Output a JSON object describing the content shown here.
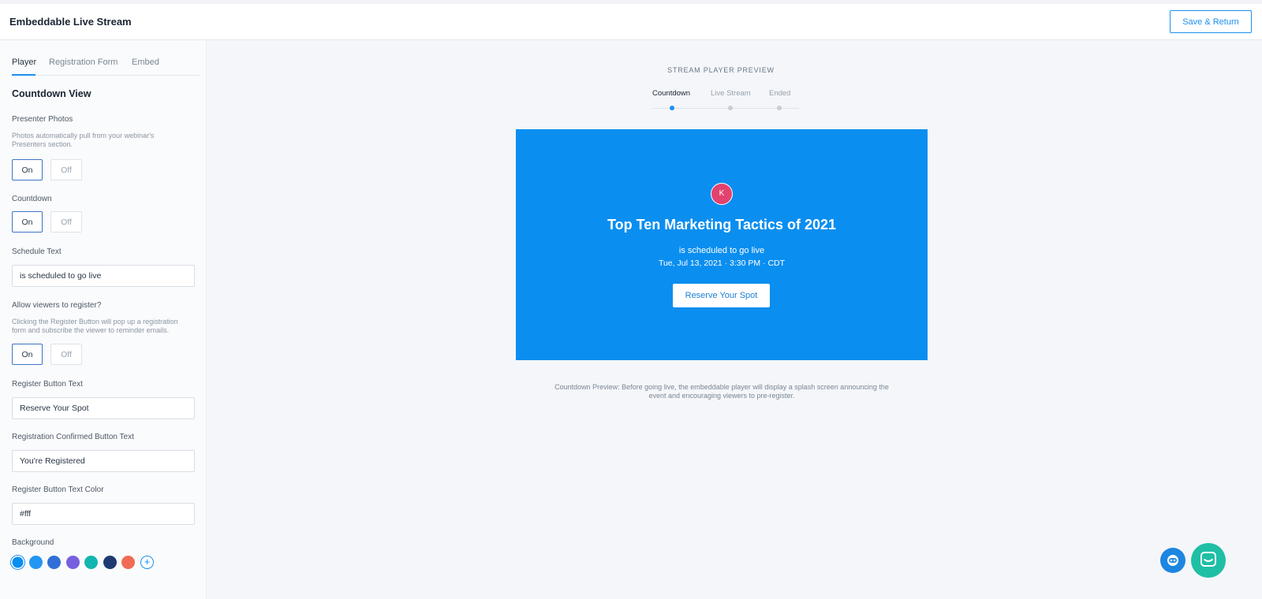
{
  "header": {
    "title": "Embeddable Live Stream",
    "save_label": "Save & Return"
  },
  "sidebar": {
    "tabs": [
      "Player",
      "Registration Form",
      "Embed"
    ],
    "active_tab": "Player",
    "section_title": "Countdown View",
    "presenter_photos": {
      "label": "Presenter Photos",
      "help": "Photos automatically pull from your webinar's Presenters section.",
      "on_label": "On",
      "off_label": "Off",
      "value": "On"
    },
    "countdown": {
      "label": "Countdown",
      "on_label": "On",
      "off_label": "Off",
      "value": "On"
    },
    "schedule_text": {
      "label": "Schedule Text",
      "value": "is scheduled to go live"
    },
    "allow_register": {
      "label": "Allow viewers to register?",
      "help": "Clicking the Register Button will pop up a registration form and subscribe the viewer to reminder emails.",
      "on_label": "On",
      "off_label": "Off",
      "value": "On"
    },
    "register_button_text": {
      "label": "Register Button Text",
      "value": "Reserve Your Spot"
    },
    "confirmed_button_text": {
      "label": "Registration Confirmed Button Text",
      "value": "You're Registered"
    },
    "register_text_color": {
      "label": "Register Button Text Color",
      "value": "#fff"
    },
    "background": {
      "label": "Background",
      "swatches": [
        "#0a8ef0",
        "#2196f3",
        "#2f6fd6",
        "#7660e0",
        "#13b5b1",
        "#1e3a72",
        "#f06b55"
      ],
      "selected_index": 0,
      "add_label": "+"
    }
  },
  "preview": {
    "label": "STREAM PLAYER PREVIEW",
    "steps": [
      "Countdown",
      "Live Stream",
      "Ended"
    ],
    "active_step": "Countdown",
    "player": {
      "background": "#0a8ef0",
      "avatar_initial": "K",
      "avatar_color": "#e2426e",
      "title": "Top Ten Marketing Tactics of 2021",
      "schedule_text": "is scheduled to go live",
      "date_text": "Tue, Jul 13, 2021 · 3:30 PM · CDT",
      "button_label": "Reserve Your Spot"
    },
    "note": "Countdown Preview: Before going live, the embeddable player will display a splash screen announcing the event and encouraging viewers to pre-register."
  },
  "widgets": {
    "help_icon": "robot-help-icon",
    "chat_icon": "chat-bubble-icon"
  }
}
